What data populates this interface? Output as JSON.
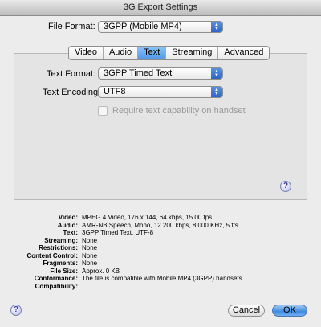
{
  "window": {
    "title": "3G Export Settings"
  },
  "file_format": {
    "label": "File Format:",
    "value": "3GPP (Mobile MP4)"
  },
  "tabs": [
    {
      "label": "Video",
      "active": false
    },
    {
      "label": "Audio",
      "active": false
    },
    {
      "label": "Text",
      "active": true
    },
    {
      "label": "Streaming",
      "active": false
    },
    {
      "label": "Advanced",
      "active": false
    }
  ],
  "text_panel": {
    "text_format": {
      "label": "Text Format:",
      "value": "3GPP Timed Text"
    },
    "text_encoding": {
      "label": "Text Encoding:",
      "value": "UTF8"
    },
    "require_capability": {
      "label": "Require text capability on handset",
      "checked": false,
      "enabled": false
    }
  },
  "summary": [
    {
      "key": "Video:",
      "value": "MPEG 4 Video, 176 x 144, 64 kbps, 15.00 fps"
    },
    {
      "key": "Audio:",
      "value": "AMR-NB Speech, Mono, 12.200 kbps, 8.000 KHz, 5 f/s"
    },
    {
      "key": "Text:",
      "value": "3GPP Timed Text, UTF-8"
    },
    {
      "key": "Streaming:",
      "value": "None"
    },
    {
      "key": "Restrictions:",
      "value": "None"
    },
    {
      "key": "Content Control:",
      "value": "None"
    },
    {
      "key": "Fragments:",
      "value": "None"
    },
    {
      "key": "File Size:",
      "value": "Approx. 0 KB"
    },
    {
      "key": "Conformance:",
      "value": "The file is compatible with Mobile MP4 (3GPP) handsets"
    },
    {
      "key": "Compatibility:",
      "value": ""
    }
  ],
  "buttons": {
    "help": "?",
    "cancel": "Cancel",
    "ok": "OK"
  },
  "colors": {
    "accent": "#4f97e9",
    "window_bg": "#ececec"
  }
}
